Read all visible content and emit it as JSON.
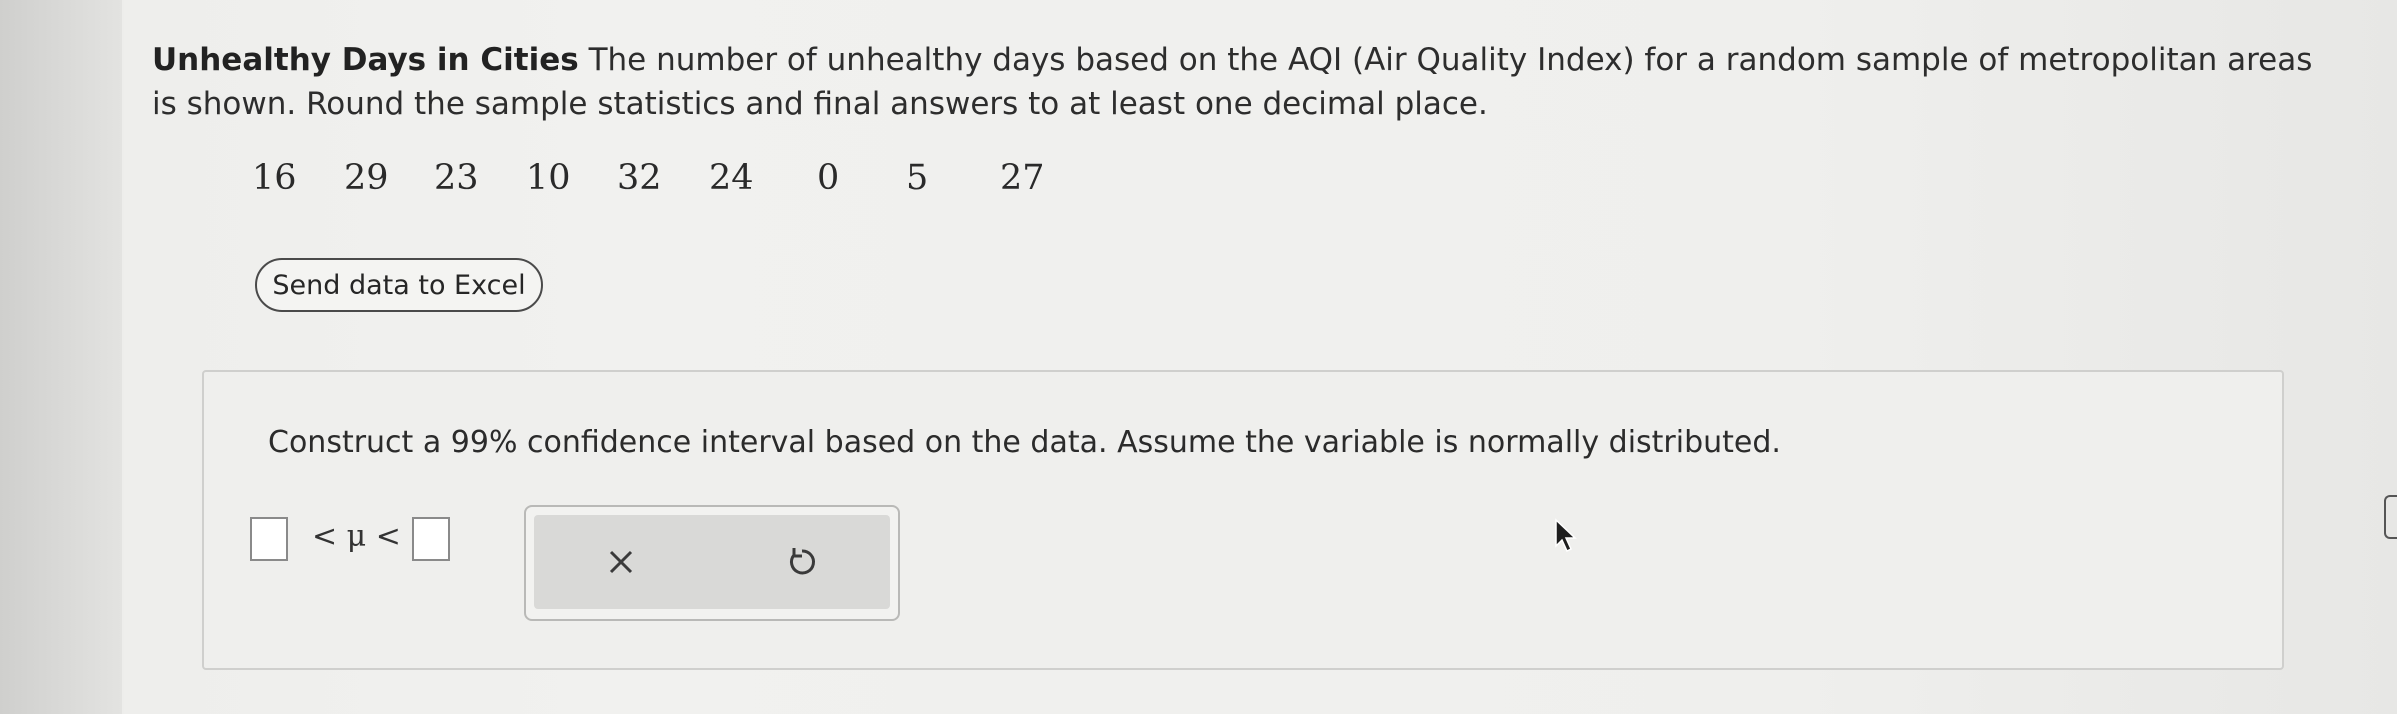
{
  "problem": {
    "title": "Unhealthy Days in Cities",
    "text": "The number of unhealthy days based on the AQI (Air Quality Index) for a random sample of metropolitan areas is shown. Round the sample statistics and final answers to at least one decimal place."
  },
  "data_values": [
    "16",
    "29",
    "23",
    "10",
    "32",
    "24",
    "0",
    "5",
    "27"
  ],
  "excel_button": {
    "label": "Send data to Excel"
  },
  "question": {
    "text": "Construct a 99% confidence interval based on the data. Assume the variable is normally distributed."
  },
  "answer": {
    "lower_value": "",
    "symbol": "< μ <",
    "upper_value": ""
  },
  "tools": {
    "clear_icon": "close-icon",
    "reset_icon": "undo-icon"
  },
  "colors": {
    "text": "#2d2d2d",
    "panel_border": "#cfcfcd",
    "tool_bg": "#d9d9d7"
  }
}
